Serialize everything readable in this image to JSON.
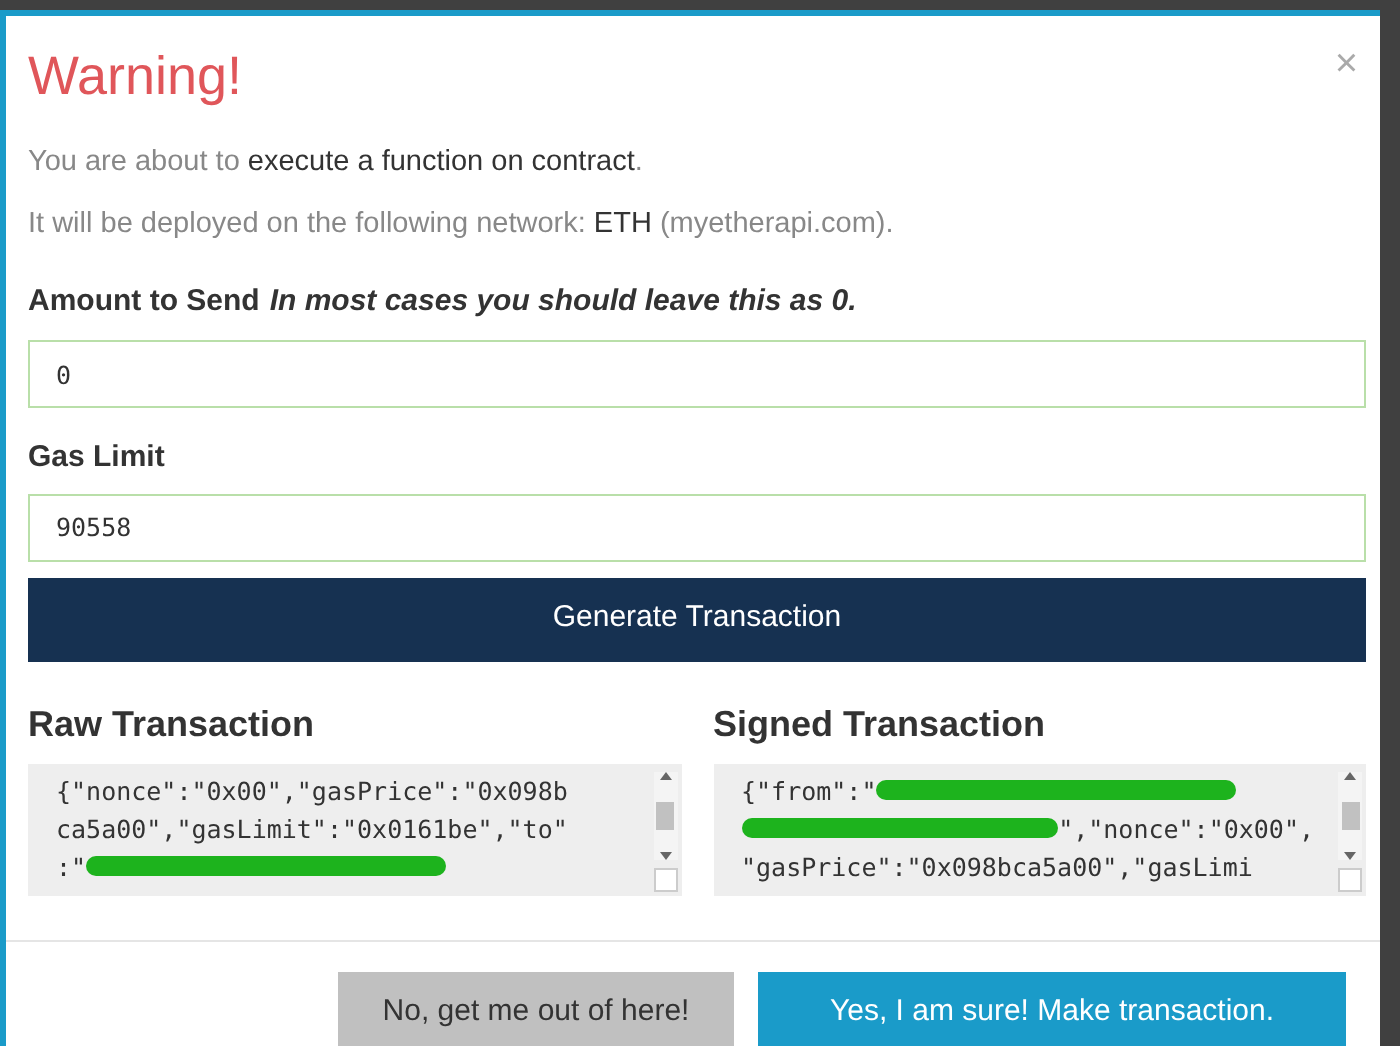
{
  "modal": {
    "title": "Warning!",
    "close": "×"
  },
  "message": {
    "line_1": "You are about to **execute a function on contract**.",
    "line_2": "It will be deployed on the following network: **ETH** (myetherapi.com)."
  },
  "amount": {
    "label": "Amount to Send",
    "hint": "In most cases you should leave this as 0.",
    "value": "0"
  },
  "gas_limit": {
    "label": "Gas Limit",
    "value": "90558"
  },
  "generate_button": "Generate Transaction",
  "raw_transaction": {
    "title": "Raw Transaction",
    "lines": [
      [
        {
          "kind": "text",
          "text": "{\"nonce\":\"0x00\",\"gasPrice\":\"0x098b"
        }
      ],
      [
        {
          "kind": "text",
          "text": "ca5a00\",\"gasLimit\":\"0x0161be\",\"to\""
        }
      ],
      [
        {
          "kind": "text",
          "text": ":\""
        },
        {
          "kind": "redacted"
        }
      ]
    ]
  },
  "signed_transaction": {
    "title": "Signed Transaction",
    "lines": [
      [
        {
          "kind": "text",
          "text": "{\"from\":\""
        },
        {
          "kind": "redacted"
        }
      ],
      [
        {
          "kind": "redacted"
        },
        {
          "kind": "text",
          "text": "\",\"nonce\":\"0x00\","
        }
      ],
      [
        {
          "kind": "text",
          "text": "\"gasPrice\":\"0x098bca5a00\",\"gasLimi"
        }
      ]
    ]
  },
  "buttons": [
    {
      "kind": "cancel",
      "label": "No, get me out of here!"
    },
    {
      "kind": "confirm",
      "label": "Yes, I am sure! Make transaction."
    }
  ]
}
